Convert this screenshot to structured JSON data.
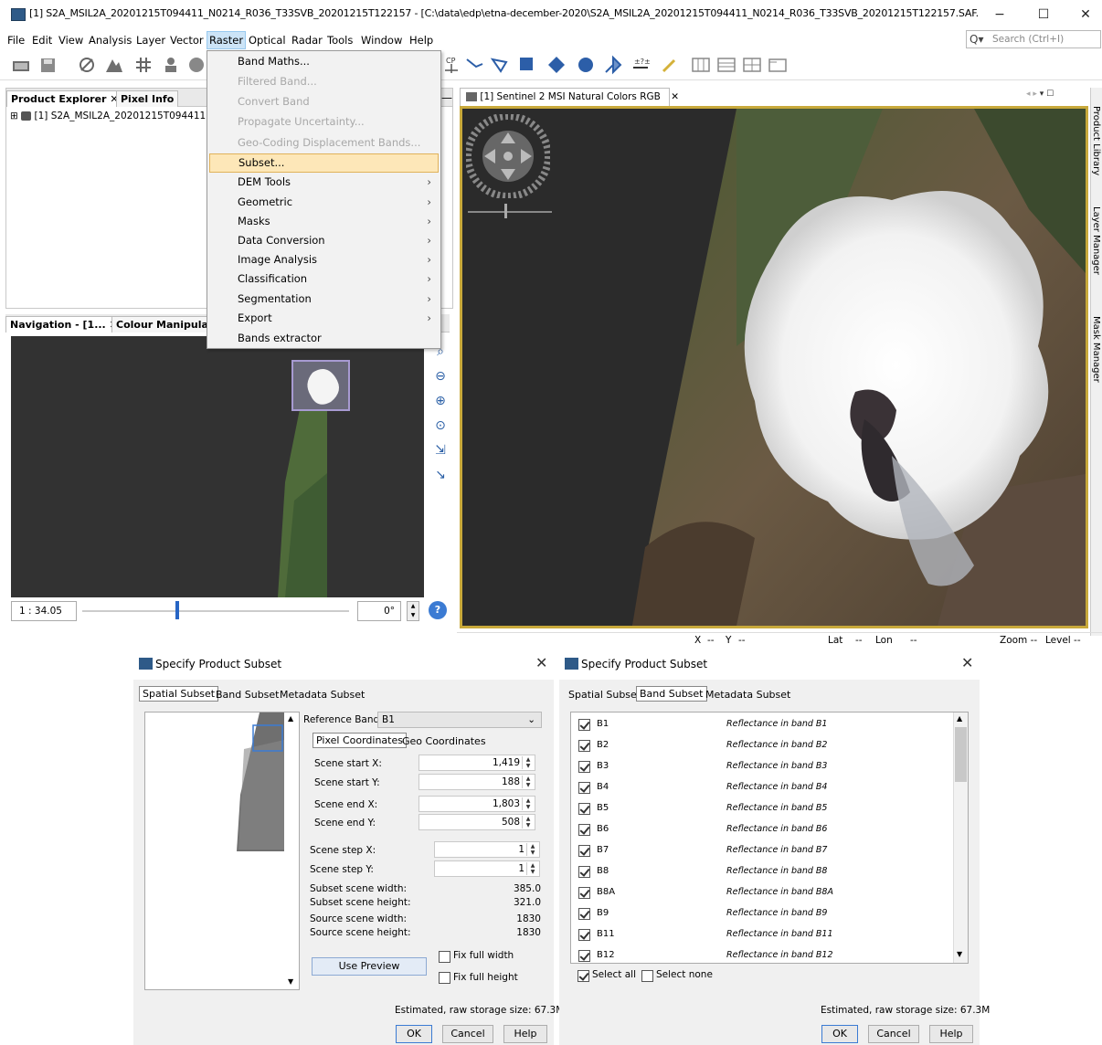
{
  "window": {
    "title": "[1] S2A_MSIL2A_20201215T094411_N0214_R036_T33SVB_20201215T122157 - [C:\\data\\edp\\etna-december-2020\\S2A_MSIL2A_20201215T094411_N0214_R036_T33SVB_20201215T122157.SAF...",
    "minimize": "−",
    "maximize": "☐",
    "close": "✕"
  },
  "menubar": [
    "File",
    "Edit",
    "View",
    "Analysis",
    "Layer",
    "Vector",
    "Raster",
    "Optical",
    "Radar",
    "Tools",
    "Window",
    "Help"
  ],
  "search": {
    "icon": "Q▾",
    "placeholder": "Search (Ctrl+I)"
  },
  "raster_menu": [
    {
      "label": "Band Maths...",
      "enabled": true
    },
    {
      "label": "Filtered Band...",
      "enabled": false
    },
    {
      "label": "Convert Band",
      "enabled": false
    },
    {
      "label": "Propagate Uncertainty...",
      "enabled": false
    },
    {
      "label": "Geo-Coding Displacement Bands...",
      "enabled": false
    },
    {
      "label": "Subset...",
      "enabled": true,
      "highlighted": true
    },
    {
      "label": "DEM Tools",
      "submenu": true
    },
    {
      "label": "Geometric",
      "submenu": true
    },
    {
      "label": "Masks",
      "submenu": true
    },
    {
      "label": "Data Conversion",
      "submenu": true
    },
    {
      "label": "Image Analysis",
      "submenu": true
    },
    {
      "label": "Classification",
      "submenu": true
    },
    {
      "label": "Segmentation",
      "submenu": true
    },
    {
      "label": "Export",
      "submenu": true
    },
    {
      "label": "Bands extractor"
    }
  ],
  "product_explorer": {
    "tabs": [
      "Product Explorer",
      "Pixel Info"
    ],
    "tab_close": "✕",
    "tree_item": "[1] S2A_MSIL2A_20201215T094411",
    "expander": "⊞"
  },
  "navigation": {
    "tabs": [
      "Navigation - [1...",
      "Colour Manipulat..."
    ],
    "scale": "1 : 34.05",
    "angle": "0°",
    "help": "?"
  },
  "image_view": {
    "tab": "[1] Sentinel 2 MSI Natural Colors RGB",
    "tab_close": "✕"
  },
  "side_tools": [
    "Product Library",
    "Layer Manager",
    "Mask Manager"
  ],
  "statusbar": {
    "x": "X",
    "x_val": "--",
    "y": "Y",
    "y_val": "--",
    "lat": "Lat",
    "lat_val": "--",
    "lon": "Lon",
    "lon_val": "--",
    "zoom": "Zoom --",
    "level": "Level --"
  },
  "dialog_spatial": {
    "title": "Specify Product Subset",
    "close": "✕",
    "tabs": [
      "Spatial Subset",
      "Band Subset",
      "Metadata Subset"
    ],
    "reference_band_label": "Reference Band:",
    "reference_band": "B1",
    "coord_tabs": [
      "Pixel Coordinates",
      "Geo Coordinates"
    ],
    "fields": [
      {
        "label": "Scene start X:",
        "value": "1,419"
      },
      {
        "label": "Scene start Y:",
        "value": "188"
      },
      {
        "label": "Scene end X:",
        "value": "1,803"
      },
      {
        "label": "Scene end Y:",
        "value": "508"
      }
    ],
    "steps": [
      {
        "label": "Scene step X:",
        "value": "1"
      },
      {
        "label": "Scene step Y:",
        "value": "1"
      }
    ],
    "info": [
      {
        "label": "Subset scene width:",
        "value": "385.0"
      },
      {
        "label": "Subset scene height:",
        "value": "321.0"
      },
      {
        "label": "Source scene width:",
        "value": "1830"
      },
      {
        "label": "Source scene height:",
        "value": "1830"
      }
    ],
    "use_preview": "Use Preview",
    "fix_width": "Fix full width",
    "fix_height": "Fix full height",
    "storage": "Estimated, raw storage size: 67.3M",
    "ok": "OK",
    "cancel": "Cancel",
    "help": "Help"
  },
  "dialog_band": {
    "title": "Specify Product Subset",
    "close": "✕",
    "tabs": [
      "Spatial Subset",
      "Band Subset",
      "Metadata Subset"
    ],
    "bands": [
      {
        "name": "B1",
        "desc": "Reflectance in band B1"
      },
      {
        "name": "B2",
        "desc": "Reflectance in band B2"
      },
      {
        "name": "B3",
        "desc": "Reflectance in band B3"
      },
      {
        "name": "B4",
        "desc": "Reflectance in band B4"
      },
      {
        "name": "B5",
        "desc": "Reflectance in band B5"
      },
      {
        "name": "B6",
        "desc": "Reflectance in band B6"
      },
      {
        "name": "B7",
        "desc": "Reflectance in band B7"
      },
      {
        "name": "B8",
        "desc": "Reflectance in band B8"
      },
      {
        "name": "B8A",
        "desc": "Reflectance in band B8A"
      },
      {
        "name": "B9",
        "desc": "Reflectance in band B9"
      },
      {
        "name": "B11",
        "desc": "Reflectance in band B11"
      },
      {
        "name": "B12",
        "desc": "Reflectance in band B12"
      }
    ],
    "select_all": "Select all",
    "select_none": "Select none",
    "storage": "Estimated, raw storage size: 67.3M",
    "ok": "OK",
    "cancel": "Cancel",
    "help": "Help"
  }
}
